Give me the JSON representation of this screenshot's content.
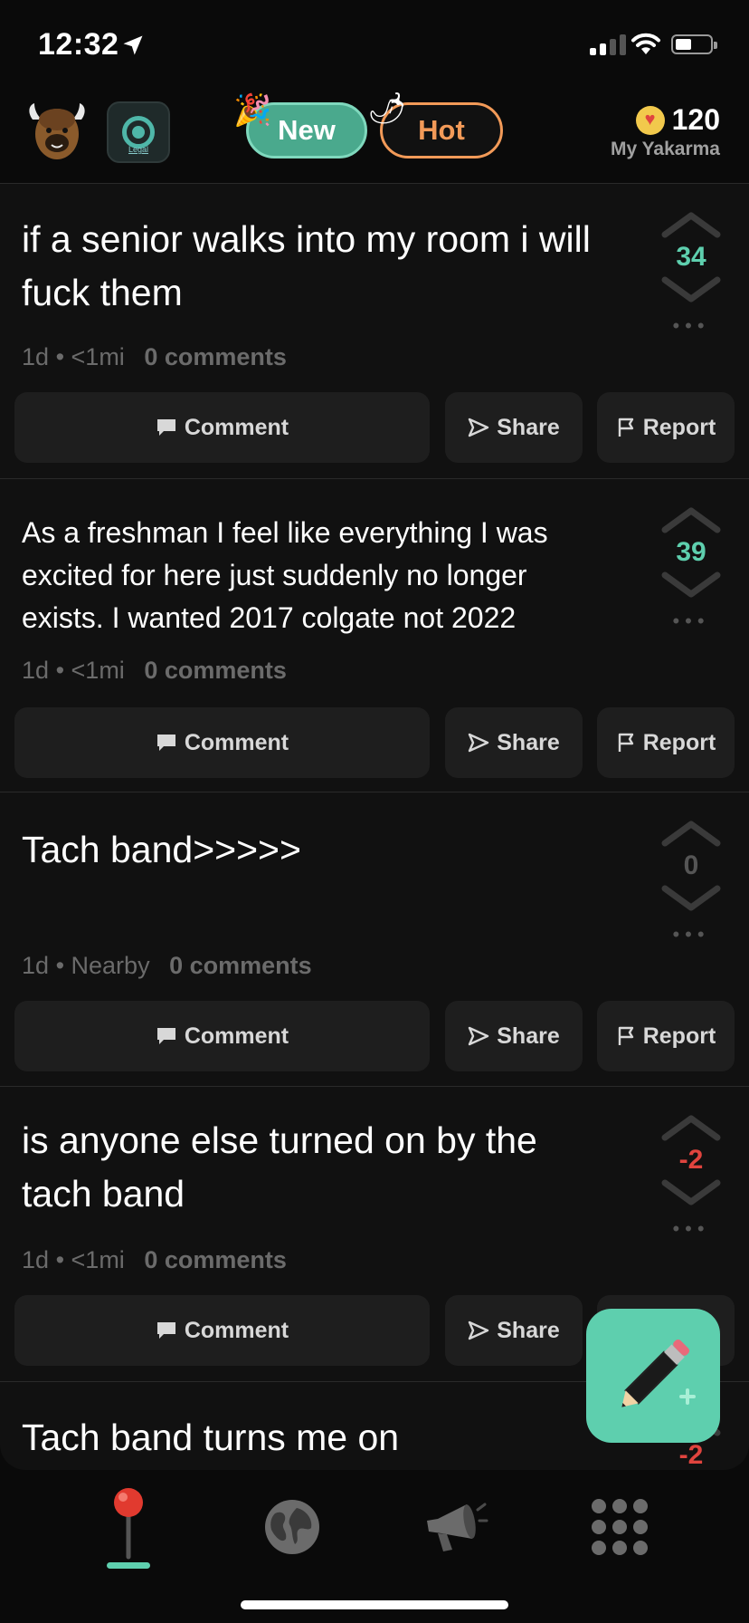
{
  "status": {
    "time": "12:32"
  },
  "header": {
    "legal_text": "Legal",
    "tabs": [
      {
        "label": "New",
        "active": true
      },
      {
        "label": "Hot",
        "active": false
      }
    ],
    "karma_value": "120",
    "karma_label": "My Yakarma"
  },
  "posts": [
    {
      "text": "if a senior walks into my room i will fuck them",
      "score": "34",
      "score_color": "#5ecfae",
      "time": "1d",
      "distance": "<1mi",
      "comments": "0 comments"
    },
    {
      "text": "As a freshman I feel like everything I was excited for here just suddenly no longer exists. I wanted 2017 colgate not 2022",
      "score": "39",
      "score_color": "#5ecfae",
      "time": "1d",
      "distance": "<1mi",
      "comments": "0 comments"
    },
    {
      "text": "Tach band>>>>>",
      "score": "0",
      "score_color": "#555555",
      "time": "1d",
      "distance": "Nearby",
      "comments": "0 comments"
    },
    {
      "text": "is anyone else turned on by the tach band",
      "score": "-2",
      "score_color": "#e0443e",
      "time": "1d",
      "distance": "<1mi",
      "comments": "0 comments"
    },
    {
      "text": "Tach band turns me on",
      "score": "-2",
      "score_color": "#e0443e"
    }
  ],
  "actions": {
    "comment": "Comment",
    "share": "Share",
    "report": "Report"
  },
  "meta_separator": "•",
  "nav": [
    {
      "icon": "map-pin-icon",
      "active": true
    },
    {
      "icon": "globe-icon",
      "active": false
    },
    {
      "icon": "megaphone-icon",
      "active": false
    },
    {
      "icon": "grid-menu-icon",
      "active": false
    }
  ],
  "colors": {
    "accent": "#5ecfae",
    "hot": "#f29a58",
    "negative": "#e0443e"
  }
}
